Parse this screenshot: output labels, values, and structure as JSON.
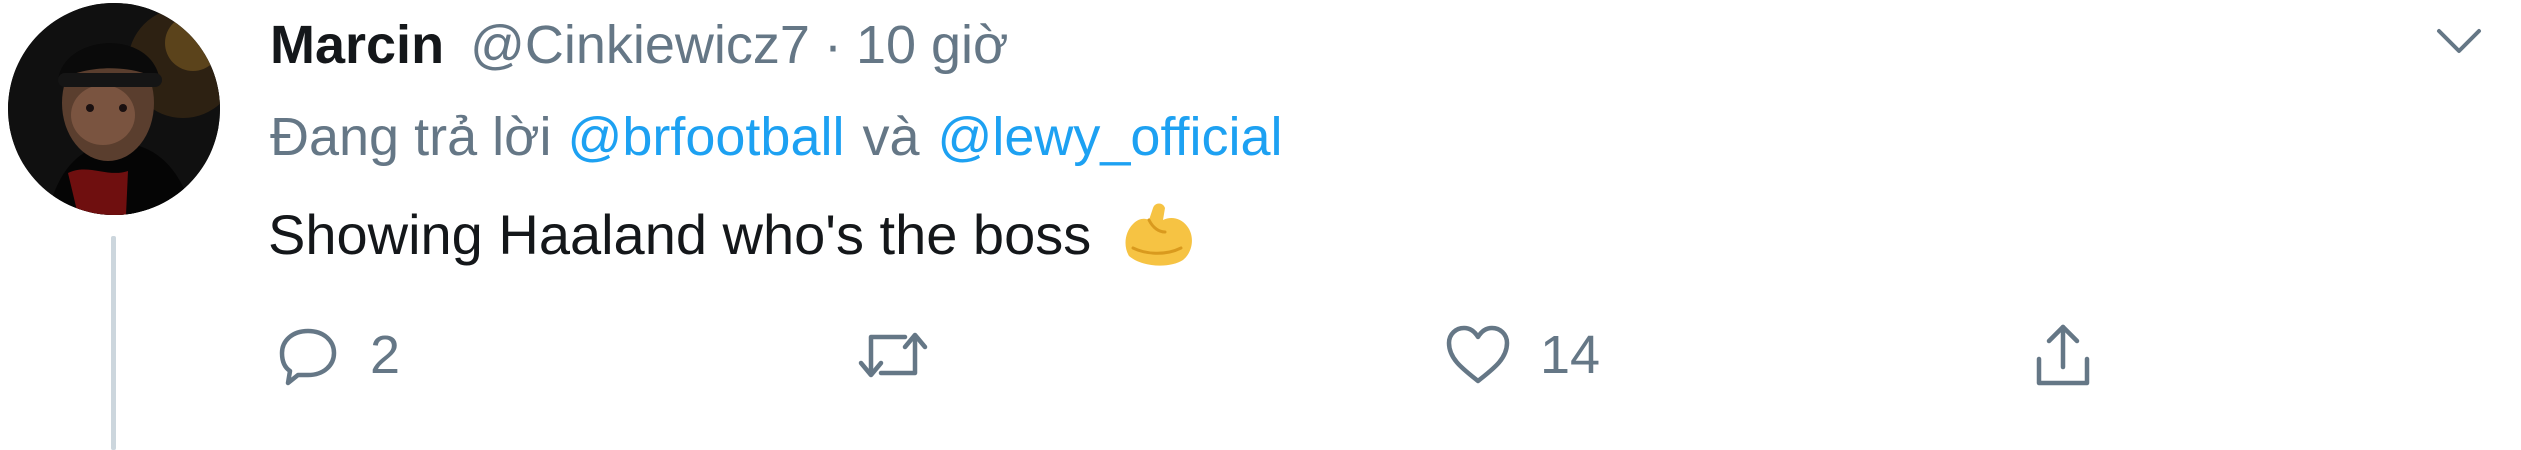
{
  "tweet": {
    "display_name": "Marcin",
    "handle": "@Cinkiewicz7",
    "separator": "·",
    "timestamp": "10 giờ",
    "reply": {
      "prefix": "Đang trả lời",
      "mention_1": "@brfootball",
      "conjunction": "và",
      "mention_2": "@lewy_official"
    },
    "text": "Showing Haaland who's the boss",
    "emoji": "flexed-biceps-emoji",
    "actions": {
      "reply_icon": "reply-bubble-icon",
      "reply_count": "2",
      "retweet_icon": "retweet-icon",
      "retweet_count": "",
      "like_icon": "heart-icon",
      "like_count": "14",
      "share_icon": "share-icon"
    },
    "menu_icon": "chevron-down-icon"
  },
  "colors": {
    "link": "#1da1f2",
    "secondary_text": "#657786",
    "primary_text": "#14171a",
    "thread_line": "#ccd6dd",
    "emoji": "#f6c343"
  }
}
